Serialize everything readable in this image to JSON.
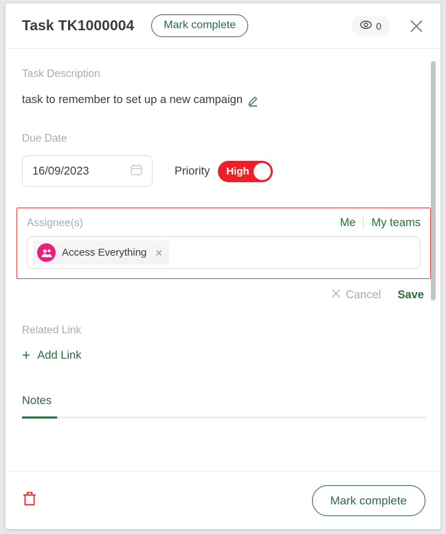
{
  "header": {
    "title": "Task TK1000004",
    "mark_complete_label": "Mark complete",
    "views_icon": "eye-icon",
    "views_count": "0",
    "close_icon": "close-icon"
  },
  "description": {
    "label": "Task Description",
    "text": "task to remember to set up a new campaign",
    "edit_icon": "pencil-edit-icon"
  },
  "due_date": {
    "label": "Due Date",
    "value": "16/09/2023",
    "calendar_icon": "calendar-icon"
  },
  "priority": {
    "label": "Priority",
    "value": "High",
    "state": "on",
    "color": "#ee2027"
  },
  "assignee": {
    "label": "Assignee(s)",
    "me_label": "Me",
    "my_teams_label": "My teams",
    "invalid": true,
    "invalid_border_color": "#e8413f",
    "chips": [
      {
        "name": "Access Everything",
        "avatar_icon": "group-avatar-icon",
        "avatar_color": "#eb1e79",
        "remove_icon": "close-icon"
      }
    ]
  },
  "actions": {
    "cancel_label": "Cancel",
    "cancel_icon": "close-icon",
    "save_label": "Save"
  },
  "related_link": {
    "label": "Related Link",
    "add_label": "Add Link",
    "add_icon": "plus-icon"
  },
  "tabs": [
    {
      "label": "Notes",
      "active": true
    }
  ],
  "footer": {
    "delete_icon": "trash-icon",
    "mark_complete_label": "Mark complete"
  },
  "colors": {
    "brand_green": "#2b6a3e",
    "danger_red": "#ee2027",
    "avatar_pink": "#eb1e79",
    "muted_label": "#a9a9b8"
  }
}
